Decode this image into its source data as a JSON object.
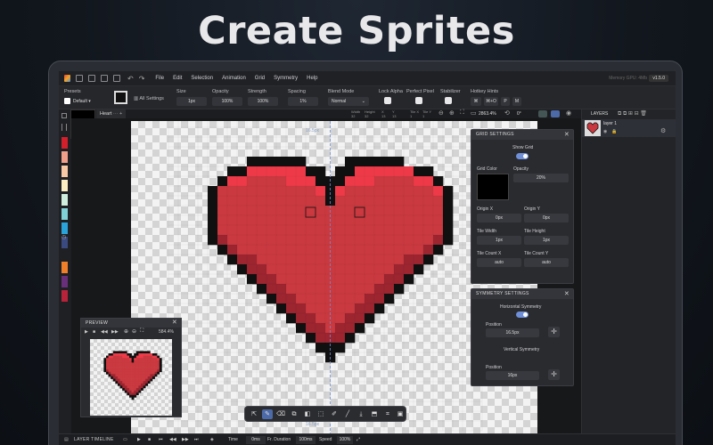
{
  "headline": "Create Sprites",
  "app": {
    "version": "v1.5.0",
    "memory": "Memory GPU: 4Mb",
    "menus": [
      "File",
      "Edit",
      "Selection",
      "Animation",
      "Grid",
      "Symmetry",
      "Help"
    ]
  },
  "toolbar": {
    "presets_label": "Presets",
    "preset_value": "Default",
    "all_settings": "All Settings",
    "size_label": "Size",
    "size_value": "1px",
    "opacity_label": "Opacity",
    "opacity_value": "100%",
    "strength_label": "Strength",
    "strength_value": "100%",
    "spacing_label": "Spacing",
    "spacing_value": "1%",
    "blend_label": "Blend Mode",
    "blend_value": "Normal",
    "lock_alpha": "Lock Alpha",
    "perfect_pixel": "Perfect Pixel",
    "stabilizer": "Stabilizer",
    "hotkey_hints": "Hotkey Hints",
    "hotkeys": [
      "⌘",
      "⌘+O",
      "P",
      "M"
    ]
  },
  "canvas": {
    "tab": "Heart",
    "zoom": "2863.4%",
    "rotation": "0°",
    "width_label": "Width",
    "width_value": "32",
    "height_label": "Height",
    "height_value": "32",
    "x_label": "X",
    "x_value": "13",
    "y_label": "Y",
    "y_value": "13",
    "tile_x_label": "Tile X",
    "tile_x_value": "1",
    "tile_y_label": "Tile Y",
    "tile_y_value": "1",
    "top_dim": "16.5px",
    "bottom_dim": "16.5px",
    "heart_rows": [
      "00000000000000000000000000000000",
      "00000000000000000000000000000000",
      "00000000000000000000000000000000",
      "00000000000000000000000000000000",
      "00000000kkkkkk0000kkkkkk00000000",
      "000000kkRRRRRRkk0kkRRRRRRkk00000",
      "00000kRRrrrrRRRkkkRRRrrrrRRk0000",
      "0000krrrrrrrrrrRkRrrrrrrrrrRk000",
      "0000krrrrrrrrrrrkrrrrrrrrrrrk000",
      "0000krrrrrrrrrrrrrrrrrrrrrrrk000",
      "0000krrrrrrrrrrrrrrrrrrrrrrrk000",
      "0000krrrrrrrrrrrrrrrrrrrrrrrk000",
      "0000kdrrrrrrrrrrrrrrrrrrrrrdk000",
      "00000kdrrrrrrrrrrrrrrrrrrrdk0000",
      "000000kddrrrrrrrrrrrrrrrddk00000",
      "0000000kddrrrrrrrrrrrrrddk000000",
      "00000000kddrrrrrrrrrrrddk0000000",
      "000000000kddrrrrrrrrrddk00000000",
      "0000000000kddrrrrrrrddk000000000",
      "00000000000kddrrrrrddk0000000000",
      "000000000000kddrrrddk00000000000",
      "0000000000000kddrddk000000000000",
      "00000000000000kdddk0000000000000",
      "000000000000000kkk00000000000000",
      "0000000000000000k000000000000000",
      "00000000000000000000000000000000",
      "00000000000000000000000000000000",
      "00000000000000000000000000000000",
      "00000000000000000000000000000000",
      "00000000000000000000000000000000",
      "00000000000000000000000000000000",
      "00000000000000000000000000000000"
    ]
  },
  "grid_settings": {
    "title": "GRID SETTINGS",
    "show_grid": "Show Grid",
    "grid_color": "Grid Color",
    "opacity_label": "Opacity",
    "opacity_value": "20%",
    "origin_x_label": "Origin X",
    "origin_x_value": "0px",
    "origin_y_label": "Origin Y",
    "origin_y_value": "0px",
    "tile_w_label": "Tile Width",
    "tile_w_value": "1px",
    "tile_h_label": "Tile Height",
    "tile_h_value": "1px",
    "count_x_label": "Tile Count X",
    "count_x_value": "auto",
    "count_y_label": "Tile Count Y",
    "count_y_value": "auto"
  },
  "symmetry_settings": {
    "title": "SYMMETRY SETTINGS",
    "horizontal": "Horizontal Symmetry",
    "h_position_label": "Position",
    "h_position_value": "16.5px",
    "vertical": "Vertical Symmetry",
    "v_position_label": "Position",
    "v_position_value": "16px"
  },
  "layers": {
    "title": "LAYERS",
    "items": [
      {
        "name": "layer 1"
      }
    ]
  },
  "preview": {
    "title": "PREVIEW",
    "zoom": "584.4%"
  },
  "timeline": {
    "title": "LAYER TIMELINE",
    "time_label": "Time",
    "time_value": "0ms",
    "fr_label": "Fr. Duration",
    "fr_value": "100ms",
    "speed_label": "Speed",
    "speed_value": "100%"
  },
  "colors": {
    "heart_red": "#c9393f",
    "heart_light": "#ee3a48",
    "heart_dark": "#9c2530",
    "outline": "#101010",
    "accent": "#6f8fd8"
  },
  "palette": [
    "#d21f2b",
    "#f0a08a",
    "#f8c9a4",
    "#fbeec2",
    "#cfeedd",
    "#7fd1d6",
    "#2aa3d8",
    "#3a4a80",
    "#f07f2a",
    "#6a2f7a",
    "#b8233a"
  ]
}
